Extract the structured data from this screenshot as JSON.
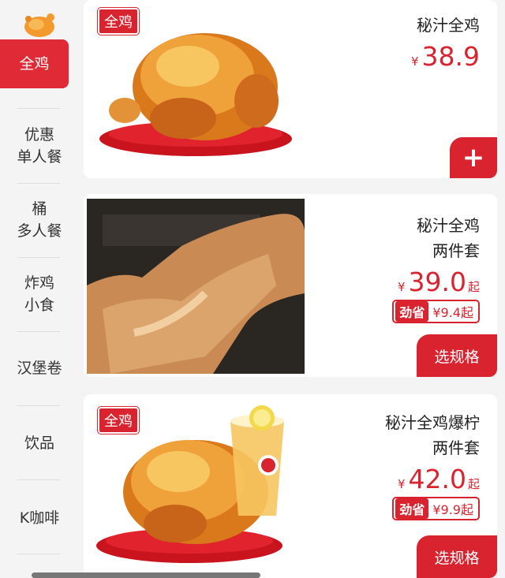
{
  "sidebar": {
    "items": [
      {
        "label": "全鸡",
        "active": true
      },
      {
        "label": "优惠\n单人餐"
      },
      {
        "label": "桶\n多人餐"
      },
      {
        "label": "炸鸡\n小食"
      },
      {
        "label": "汉堡卷"
      },
      {
        "label": "饮品"
      },
      {
        "label": "K咖啡"
      }
    ]
  },
  "products": [
    {
      "tag": "全鸡",
      "name": "秘汁全鸡",
      "currency": "¥",
      "price": "38.9",
      "suffix": "",
      "action": "+"
    },
    {
      "name": "秘汁全鸡\n两件套",
      "currency": "¥",
      "price": "39.0",
      "suffix": "起",
      "save_label": "劲省",
      "save_value": "¥9.4起",
      "action": "选规格"
    },
    {
      "tag": "全鸡",
      "name": "秘汁全鸡爆柠\n两件套",
      "currency": "¥",
      "price": "42.0",
      "suffix": "起",
      "save_label": "劲省",
      "save_value": "¥9.9起",
      "action": "选规格"
    }
  ],
  "colors": {
    "accent": "#d9242f"
  }
}
